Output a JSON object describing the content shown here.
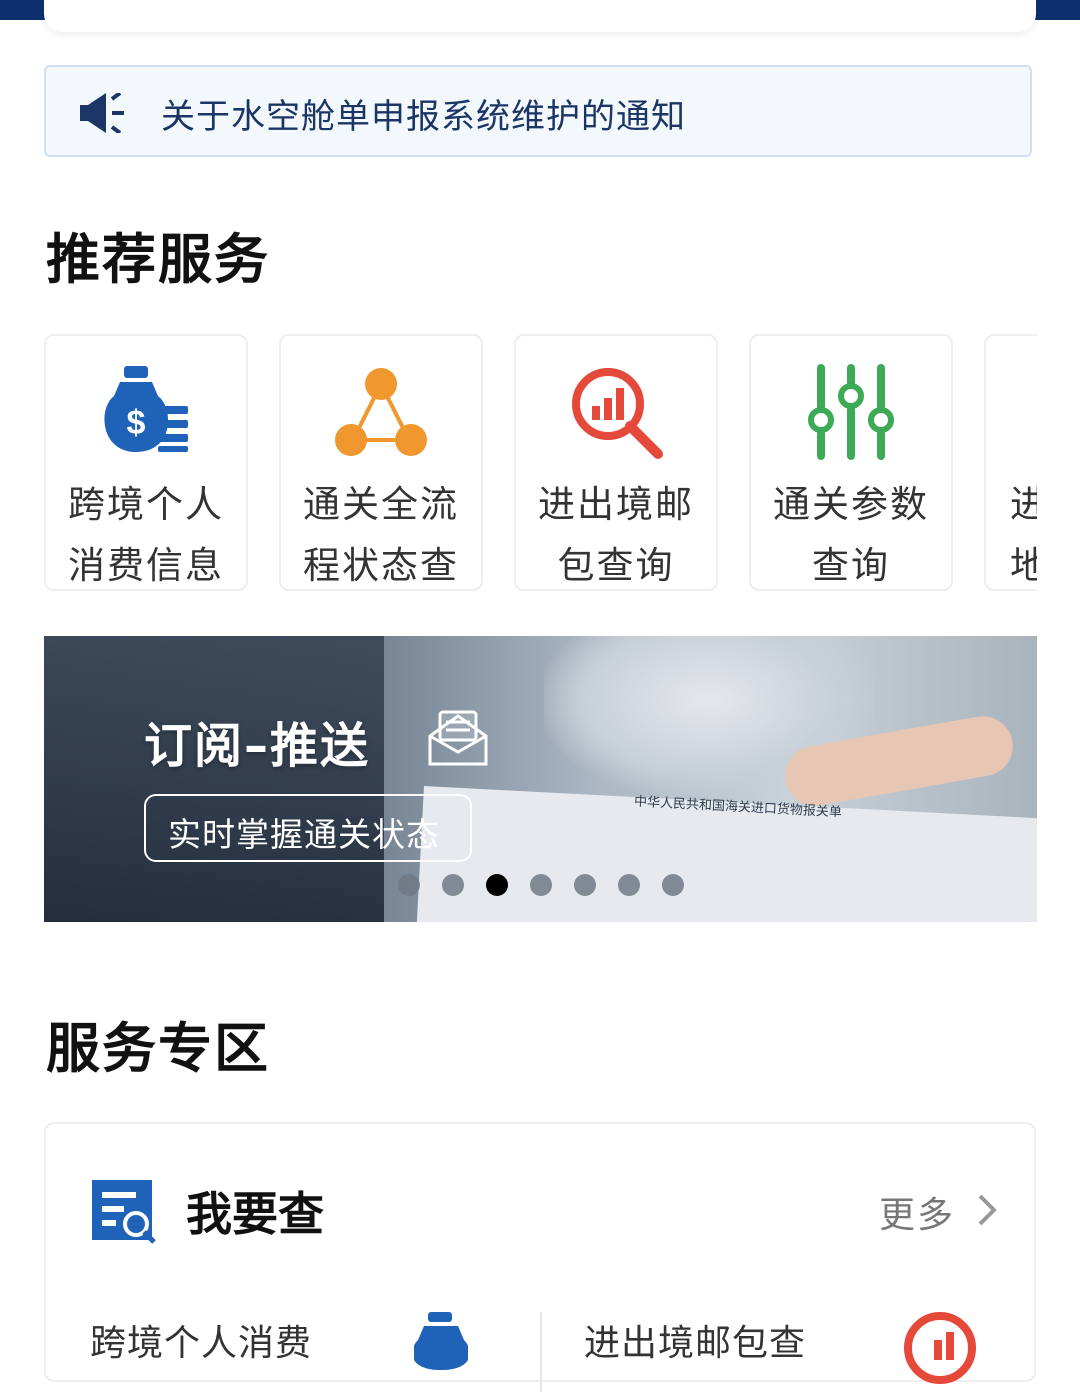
{
  "notice": {
    "text": "关于水空舱单申报系统维护的通知",
    "icon": "speaker-icon"
  },
  "recommended": {
    "heading": "推荐服务",
    "items": [
      {
        "line1": "跨境个人",
        "line2": "消费信息",
        "icon": "money-bag-icon",
        "color": "#1e63b8"
      },
      {
        "line1": "通关全流",
        "line2": "程状态查",
        "icon": "network-icon",
        "color": "#f0972d"
      },
      {
        "line1": "进出境邮",
        "line2": "包查询",
        "icon": "chart-search-icon",
        "color": "#e5493a"
      },
      {
        "line1": "通关参数",
        "line2": "查询",
        "icon": "sliders-icon",
        "color": "#3daa55"
      },
      {
        "line1": "进",
        "line2": "地",
        "icon": "",
        "color": "#333333"
      }
    ]
  },
  "banner": {
    "title": "订阅–推送",
    "subtitle": "实时掌握通关状态",
    "doc_title": "中华人民共和国海关进口货物报关单",
    "dots_total": 7,
    "active_dot": 3
  },
  "service_zone": {
    "heading": "服务专区",
    "card_title": "我要查",
    "more_label": "更多",
    "item_left": "跨境个人消费",
    "item_right": "进出境邮包查"
  },
  "colors": {
    "navy": "#0d2f6e",
    "blue": "#1e63b8"
  }
}
